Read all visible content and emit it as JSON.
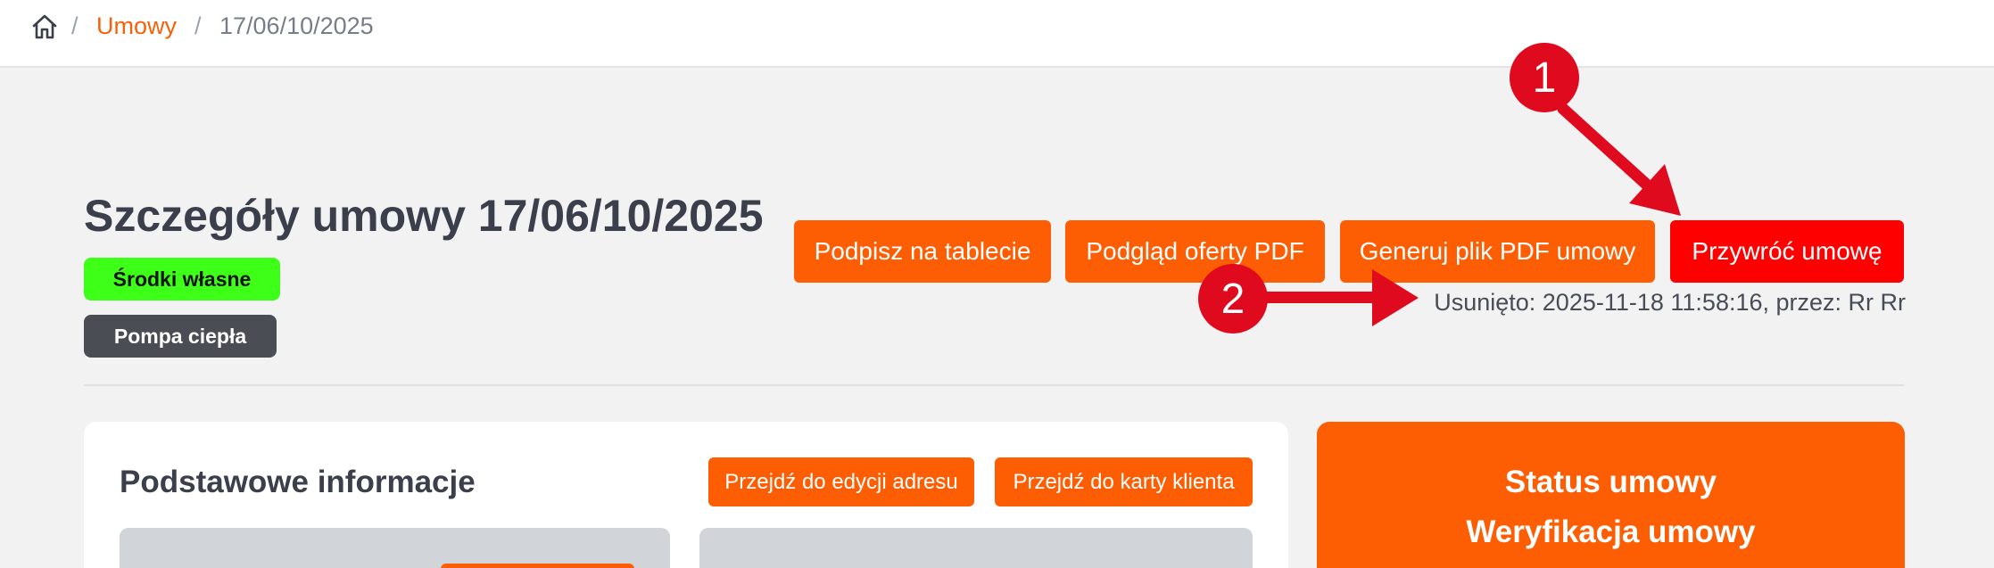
{
  "breadcrumb": {
    "home_icon": "home-icon",
    "separator": "/",
    "link": "Umowy",
    "current": "17/06/10/2025"
  },
  "header": {
    "title": "Szczegóły umowy 17/06/10/2025",
    "badges": [
      {
        "label": "Środki własne",
        "color": "#3dff17"
      },
      {
        "label": "Pompa ciepła",
        "color": "#4b4d55"
      }
    ]
  },
  "actions": {
    "sign_tablet": "Podpisz na tablecie",
    "preview_offer_pdf": "Podgląd oferty PDF",
    "generate_contract_pdf": "Generuj plik PDF umowy",
    "restore_contract": "Przywróć umowę"
  },
  "deleted_info": "Usunięto: 2025-11-18 11:58:16, przez: Rr Rr",
  "basic_info": {
    "title": "Podstawowe informacje",
    "edit_address_button": "Przejdź do edycji adresu",
    "client_card_button": "Przejdź do karty klienta"
  },
  "status_card": {
    "title": "Status umowy",
    "value": "Weryfikacja umowy"
  },
  "annotations": {
    "marker_1": "1",
    "marker_2": "2"
  },
  "colors": {
    "accent": "#fd5d03",
    "danger": "#ff0000",
    "annotation": "#e00a1f"
  }
}
